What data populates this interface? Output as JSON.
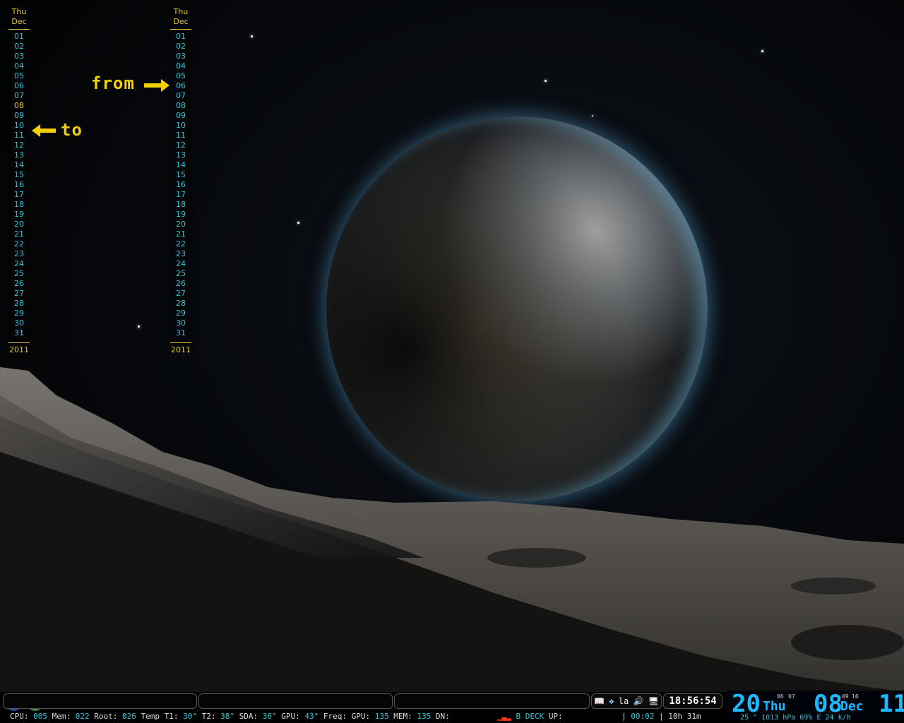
{
  "calendar_left": {
    "weekday": "Thu",
    "month": "Dec",
    "days": [
      "01",
      "02",
      "03",
      "04",
      "05",
      "06",
      "07",
      "08",
      "09",
      "10",
      "11",
      "12",
      "13",
      "14",
      "15",
      "16",
      "17",
      "18",
      "19",
      "20",
      "21",
      "22",
      "23",
      "24",
      "25",
      "26",
      "27",
      "28",
      "29",
      "30",
      "31"
    ],
    "highlighted_day": "08",
    "year": "2011"
  },
  "calendar_right": {
    "weekday": "Thu",
    "month": "Dec",
    "days": [
      "01",
      "02",
      "03",
      "04",
      "05",
      "06",
      "07",
      "08",
      "09",
      "10",
      "11",
      "12",
      "13",
      "14",
      "15",
      "16",
      "17",
      "18",
      "19",
      "20",
      "21",
      "22",
      "23",
      "24",
      "25",
      "26",
      "27",
      "28",
      "29",
      "30",
      "31"
    ],
    "year": "2011"
  },
  "annotations": {
    "from_label": "from",
    "to_label": "to"
  },
  "panel": {
    "tray_items": [
      "📖",
      "❖",
      "la",
      "🔊",
      "🖥"
    ],
    "clock": "18:56:54",
    "status": {
      "cpu_label": "CPU:",
      "cpu": "005",
      "mem_label": "Mem:",
      "mem": "022",
      "root_label": "Root:",
      "root": "026",
      "temp_label": "Temp T1:",
      "t1": "30°",
      "t2_label": "T2:",
      "t2": "38°",
      "sda_label": "SDA:",
      "sda": "36°",
      "gpu_label": "GPU:",
      "gpu": "43°",
      "freq_label": "Freq: GPU:",
      "freq_gpu": "135",
      "freq_mem_label": "MEM:",
      "freq_mem": "135",
      "dn_label": "DN:",
      "deck_label": "B DECK",
      "up_label": "UP:",
      "sep": "|",
      "uptime_short": "00:02",
      "uptime": "10h 31m"
    },
    "big_date": {
      "day": "20",
      "weekday": "Thu",
      "prev_day": "06",
      "next_day": "07",
      "month_num": "08",
      "month": "Dec",
      "prev_mon": "09",
      "next_mon": "10",
      "year": "11",
      "weather": "25 ° 1013 hPa 69% E 24 k/h"
    }
  },
  "colors": {
    "accent_cyan": "#36c4d8",
    "accent_yellow": "#e8c830",
    "annotation_yellow": "#f0d000",
    "big_date_blue": "#1fb8ff"
  }
}
